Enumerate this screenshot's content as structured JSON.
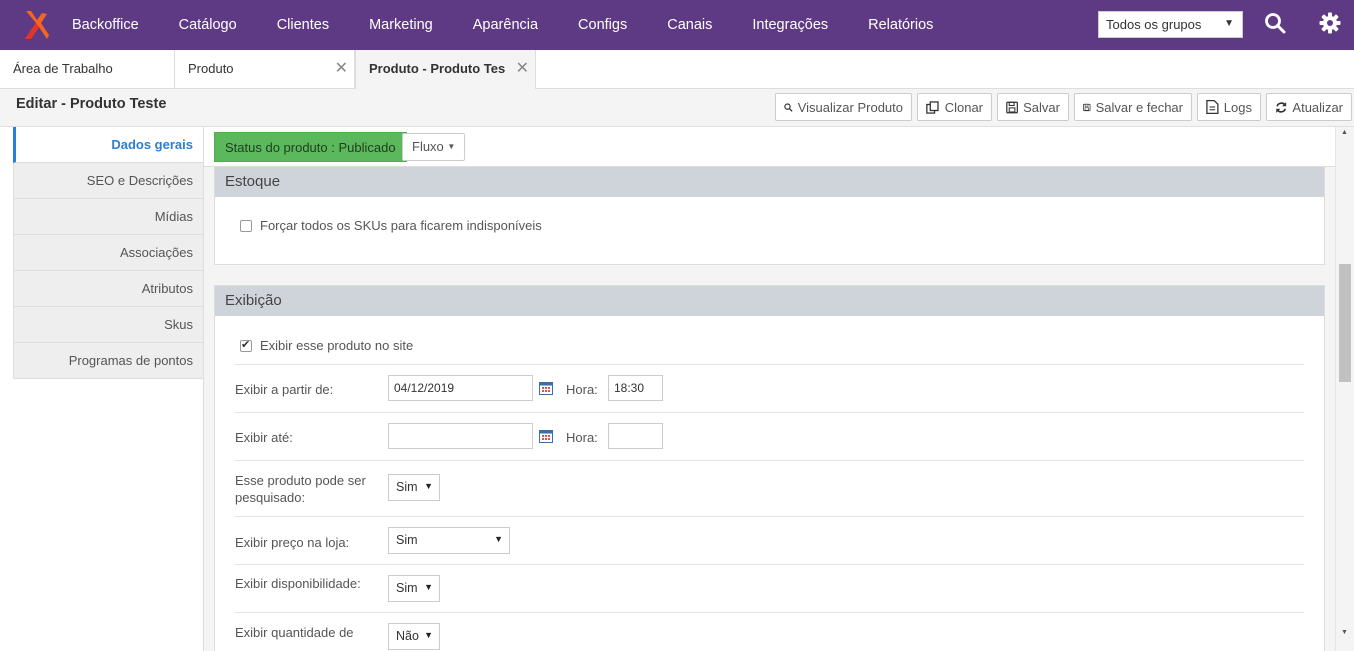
{
  "nav": {
    "items": [
      "Backoffice",
      "Catálogo",
      "Clientes",
      "Marketing",
      "Aparência",
      "Configs",
      "Canais",
      "Integrações",
      "Relatórios"
    ],
    "group_select": "Todos os grupos"
  },
  "tabs": [
    {
      "label": "Área de Trabalho"
    },
    {
      "label": "Produto",
      "close": "✕"
    },
    {
      "label": "Produto - Produto Teste",
      "close": "✕"
    }
  ],
  "page": {
    "title": "Editar - Produto Teste"
  },
  "toolbar": {
    "view": "Visualizar Produto",
    "clone": "Clonar",
    "save": "Salvar",
    "save_close": "Salvar e fechar",
    "logs": "Logs",
    "refresh": "Atualizar"
  },
  "sidebar": {
    "items": [
      "Dados gerais",
      "SEO e Descrições",
      "Mídias",
      "Associações",
      "Atributos",
      "Skus",
      "Programas de pontos"
    ]
  },
  "status": {
    "label": "Status do produto : Publicado",
    "flow": "Fluxo"
  },
  "estoque": {
    "title": "Estoque",
    "force_unavailable": "Forçar todos os SKUs para ficarem indisponíveis",
    "force_unavailable_checked": false
  },
  "exibicao": {
    "title": "Exibição",
    "show_on_site": "Exibir esse produto no site",
    "show_on_site_checked": true,
    "from_label": "Exibir a partir de:",
    "from_date": "04/12/2019",
    "hora_label": "Hora:",
    "from_time": "18:30",
    "until_label": "Exibir até:",
    "until_date": "",
    "until_time": "",
    "searchable_label": "Esse produto pode ser pesquisado:",
    "searchable_value": "Sim",
    "show_price_label": "Exibir preço na loja:",
    "show_price_value": "Sim",
    "availability_label": "Exibir disponibilidade:",
    "availability_value": "Sim",
    "stock_qty_label": "Exibir quantidade de",
    "stock_qty_value": "Não"
  },
  "colors": {
    "nav_bg": "#5f3a84",
    "status_green": "#5cb85c",
    "active_blue": "#2a7fd6"
  }
}
